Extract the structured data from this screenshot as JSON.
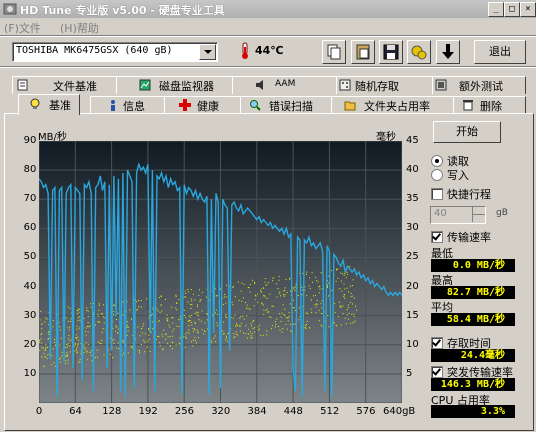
{
  "window": {
    "title": "HD Tune 专业版 v5.00 - 硬盘专业工具",
    "controls": [
      "_",
      "□",
      "×"
    ]
  },
  "menu": [
    {
      "label": "(F)文件"
    },
    {
      "label": "(H)帮助"
    }
  ],
  "toolbar": {
    "drive_selected": "TOSHIBA MK6475GSX (640 gB)",
    "temperature": "44℃",
    "icons": [
      "copy-icon",
      "paste-icon",
      "save-icon",
      "options-icon",
      "download-icon"
    ],
    "exit_label": "退出"
  },
  "tabs_top": [
    {
      "label": "文件基准",
      "icon": "file-benchmark-icon"
    },
    {
      "label": "磁盘监视器",
      "icon": "disk-monitor-icon"
    },
    {
      "label": "AAM",
      "icon": "speaker-icon"
    },
    {
      "label": "随机存取",
      "icon": "random-access-icon"
    },
    {
      "label": "额外测试",
      "icon": "extra-tests-icon"
    }
  ],
  "tabs_bottom": [
    {
      "label": "基准",
      "icon": "lightbulb-icon",
      "active": true
    },
    {
      "label": "信息",
      "icon": "info-icon"
    },
    {
      "label": "健康",
      "icon": "health-cross-icon"
    },
    {
      "label": "错误扫描",
      "icon": "magnifier-icon"
    },
    {
      "label": "文件夹占用率",
      "icon": "folder-icon"
    },
    {
      "label": "删除",
      "icon": "trash-icon"
    }
  ],
  "benchmark": {
    "start_label": "开始",
    "read_label": "读取",
    "write_label": "写入",
    "mode": "read",
    "short_stroke_label": "快捷行程",
    "short_stroke_checked": false,
    "short_stroke_value": "40",
    "short_stroke_unit": "gB",
    "transfer_rate_label": "传输速率",
    "transfer_rate_checked": true,
    "min_label": "最低",
    "min_value": "0.0 MB/秒",
    "max_label": "最高",
    "max_value": "82.7 MB/秒",
    "avg_label": "平均",
    "avg_value": "58.4 MB/秒",
    "access_time_label": "存取时间",
    "access_time_checked": true,
    "access_time_value": "24.4毫秒",
    "burst_rate_label": "突发传输速率",
    "burst_rate_checked": true,
    "burst_rate_value": "146.3 MB/秒",
    "cpu_label": "CPU 占用率",
    "cpu_value": "3.3%"
  },
  "chart_data": {
    "type": "line",
    "ylabel": "MB/秒",
    "y2label": "毫秒",
    "xlabel": "",
    "x_ticks": [
      "0",
      "64",
      "128",
      "192",
      "256",
      "320",
      "384",
      "448",
      "512",
      "576",
      "640gB"
    ],
    "y_ticks": [
      "90",
      "80",
      "70",
      "60",
      "50",
      "40",
      "30",
      "20",
      "10"
    ],
    "y2_ticks": [
      "45",
      "40",
      "35",
      "30",
      "25",
      "20",
      "15",
      "10",
      "5"
    ],
    "xlim": [
      0,
      640
    ],
    "ylim": [
      0,
      90
    ],
    "y2lim": [
      0,
      45
    ],
    "grid": true,
    "series": [
      {
        "name": "传输速率",
        "color": "#2aa7de",
        "x": [
          0,
          4,
          8,
          12,
          16,
          20,
          24,
          28,
          32,
          36,
          40,
          44,
          48,
          52,
          56,
          60,
          64,
          68,
          72,
          76,
          80,
          84,
          88,
          92,
          96,
          100,
          104,
          108,
          112,
          116,
          120,
          124,
          128,
          132,
          136,
          140,
          144,
          148,
          152,
          156,
          160,
          164,
          168,
          172,
          176,
          180,
          184,
          188,
          192,
          196,
          200,
          204,
          208,
          212,
          216,
          220,
          224,
          228,
          232,
          236,
          240,
          244,
          248,
          252,
          256,
          260,
          264,
          268,
          272,
          276,
          280,
          284,
          288,
          292,
          296,
          300,
          304,
          308,
          312,
          316,
          320,
          324,
          328,
          332,
          336,
          340,
          344,
          348,
          352,
          356,
          360,
          364,
          368,
          372,
          376,
          380,
          384,
          388,
          392,
          396,
          400,
          404,
          408,
          412,
          416,
          420,
          424,
          428,
          432,
          436,
          440,
          444,
          448,
          452,
          456,
          460,
          464,
          468,
          472,
          476,
          480,
          484,
          488,
          492,
          496,
          500,
          504,
          508,
          512,
          516,
          520,
          524,
          528,
          532,
          536,
          540,
          544,
          548,
          552,
          556,
          560,
          564,
          568,
          572,
          576,
          580,
          584,
          588,
          592,
          596,
          600,
          604,
          608,
          612,
          616,
          620,
          624,
          628,
          632,
          636,
          640
        ],
        "values": [
          77,
          76,
          74,
          75,
          72,
          15,
          73,
          74,
          2,
          73,
          74,
          14,
          72,
          74,
          75,
          12,
          74,
          73,
          72,
          8,
          75,
          74,
          76,
          72,
          4,
          74,
          75,
          78,
          73,
          76,
          12,
          75,
          18,
          78,
          30,
          77,
          4,
          79,
          2,
          80,
          78,
          76,
          5,
          79,
          82,
          80,
          81,
          79,
          82,
          24,
          80,
          4,
          78,
          77,
          79,
          76,
          78,
          74,
          77,
          75,
          76,
          73,
          74,
          3,
          75,
          72,
          74,
          73,
          71,
          73,
          70,
          72,
          70,
          69,
          71,
          3,
          70,
          24,
          72,
          69,
          5,
          70,
          68,
          67,
          18,
          68,
          69,
          67,
          66,
          68,
          65,
          66,
          67,
          66,
          65,
          64,
          63,
          64,
          62,
          63,
          62,
          61,
          62,
          60,
          61,
          60,
          59,
          60,
          58,
          60,
          57,
          58,
          12,
          4,
          57,
          56,
          2,
          56,
          55,
          57,
          54,
          55,
          53,
          54,
          55,
          52,
          4,
          54,
          52,
          2,
          51,
          50,
          48,
          47,
          49,
          45,
          47,
          46,
          45,
          46,
          44,
          45,
          43,
          44,
          42,
          43,
          41,
          42,
          40,
          41,
          40,
          39,
          40,
          38,
          37,
          38,
          37,
          38,
          37,
          38,
          37
        ],
        "values_end_note": ""
      },
      {
        "name": "存取时间",
        "color": "#f0f000",
        "type": "scatter",
        "range_ms": [
          10,
          30
        ],
        "note": ""
      }
    ]
  }
}
